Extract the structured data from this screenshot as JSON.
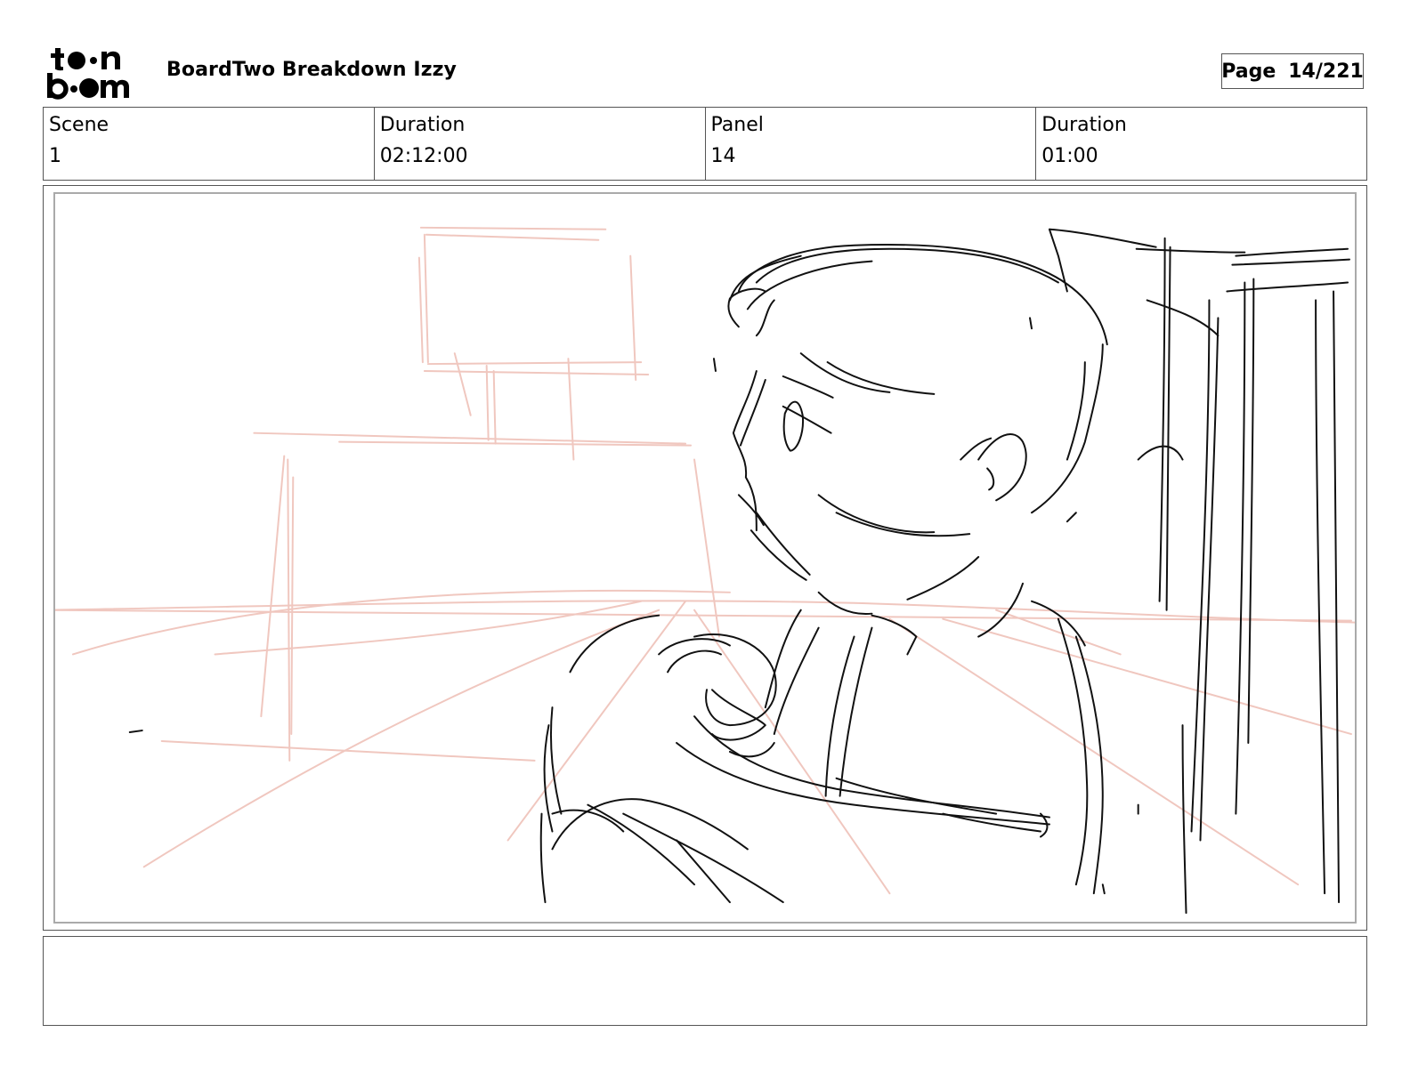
{
  "header": {
    "logo_text": "toonboom",
    "document_title": "BoardTwo Breakdown Izzy",
    "page_label": "Page",
    "page_number": "14/221"
  },
  "info": {
    "scene_label": "Scene",
    "scene_value": "1",
    "scene_duration_label": "Duration",
    "scene_duration_value": "02:12:00",
    "panel_label": "Panel",
    "panel_value": "14",
    "panel_duration_label": "Duration",
    "panel_duration_value": "01:00"
  },
  "panel": {
    "image": "storyboard-sketch",
    "sketch_color": "#111111",
    "guide_color": "#f0c7bf"
  },
  "notes": {
    "text": ""
  }
}
